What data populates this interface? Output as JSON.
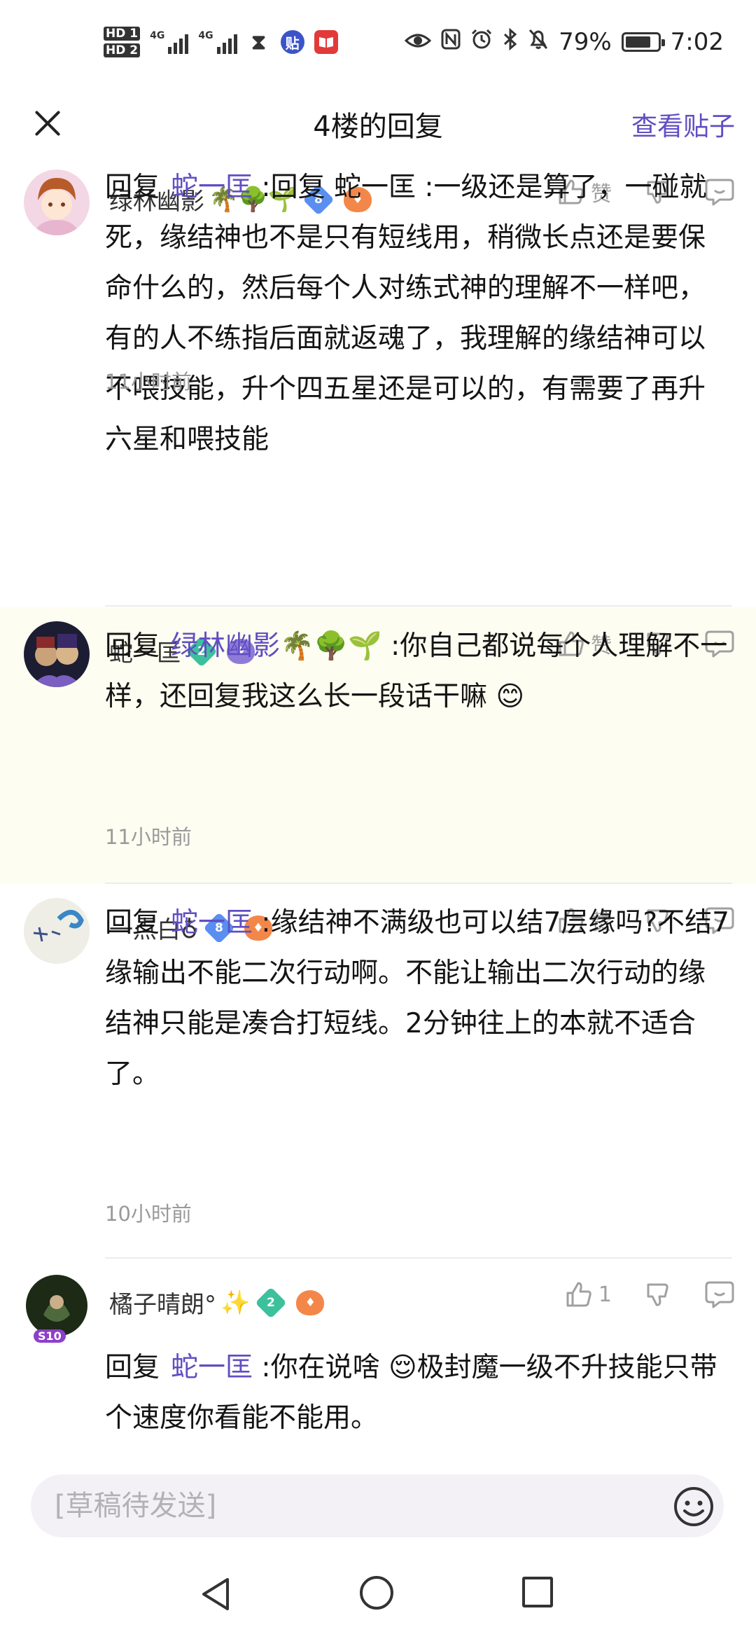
{
  "status_bar": {
    "hd1": "HD 1",
    "hd2": "HD 2",
    "net1": "4G",
    "net2": "4G",
    "tieba_icon": "贴",
    "battery": "79%",
    "battery_level": 0.79,
    "time": "7:02",
    "icons": [
      "eye-icon",
      "nfc-icon",
      "alarm-icon",
      "bluetooth-icon",
      "mute-icon",
      "battery-icon"
    ]
  },
  "header": {
    "title": "4楼的回复",
    "action": "查看贴子"
  },
  "actions": {
    "like": "赞"
  },
  "colors": {
    "accent": "#614ec2",
    "highlight_bg": "#fdfdf1"
  },
  "comments": [
    {
      "user": "绿林幽影",
      "user_emojis": "🌴🌳🌱",
      "level": "8",
      "reply_prefix": "回复",
      "reply_to": "蛇一匡",
      "text": " :回复 蛇一匡 :一级还是算了，一碰就死，缘结神也不是只有短线用，稍微长点还是要保命什么的，然后每个人对练式神的理解不一样吧，有的人不练指后面就返魂了，我理解的缘结神可以不喂技能，升个四五星还是可以的，有需要了再升六星和喂技能",
      "time": "11小时前",
      "likes": "赞"
    },
    {
      "user": "蛇一匡",
      "level": "2",
      "reply_prefix": "回复",
      "reply_to": "绿林幽影🌴🌳🌱",
      "text": " :你自己都说每个人理解不一样，还回复我这么长一段话干嘛 ",
      "text_emoji": "😊",
      "time": "11小时前",
      "likes": "赞"
    },
    {
      "user": "一点白♁",
      "level": "8",
      "reply_prefix": "回复",
      "reply_to": "蛇一匡",
      "text": " :缘结神不满级也可以结7层缘吗?不结7缘输出不能二次行动啊。不能让输出二次行动的缘结神只能是凑合打短线。2分钟往上的本就不适合了。",
      "time": "10小时前",
      "likes": "赞"
    },
    {
      "user": "橘子晴朗°",
      "user_emojis": "✨",
      "level": "2",
      "reply_prefix": "回复",
      "reply_to": "蛇一匡",
      "text": " :你在说啥 ",
      "text_emoji": "😌",
      "text2": "极封魔一级不升技能只带个速度你看能不能用。",
      "likes": "1",
      "avatar_badge": "S10"
    }
  ],
  "input": {
    "placeholder": "[草稿待发送]"
  }
}
